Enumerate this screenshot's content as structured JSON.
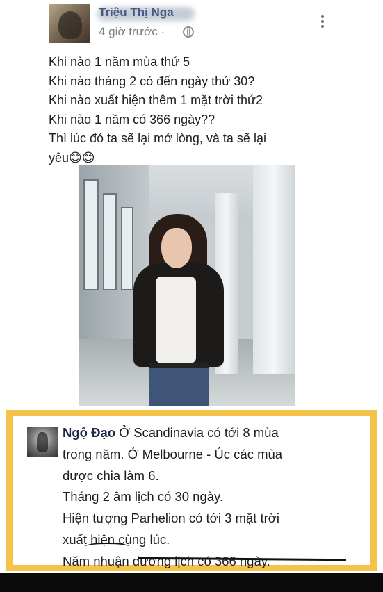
{
  "post": {
    "author": "Triệu Thị Nga",
    "time": "4 giờ trước",
    "time_separator": "·",
    "lines": [
      "Khi nào 1 năm mùa thứ 5",
      "Khi nào tháng 2 có đến ngày thứ 30?",
      "Khi nào xuất hiện thêm 1 mặt trời thứ2",
      "Khi nào 1 năm có 366 ngày??",
      "Thì lúc đó ta sẽ lại mở lòng, và ta sẽ lại",
      "yêu😊😊"
    ]
  },
  "comment": {
    "author": "Ngộ Đạo",
    "first_line": " Ở Scandinavia có tới 8 mùa",
    "lines": [
      "trong năm. Ở Melbourne - Úc các mùa",
      "được chia làm 6.",
      "Tháng 2 âm lịch có 30 ngày.",
      "Hiện tượng Parhelion có tới 3 mặt trời",
      "xuất hiện cùng lúc.",
      "Năm nhuận dương lịch có 366 ngày."
    ]
  },
  "icons": {
    "globe": "globe-icon",
    "more": "more-vertical-icon"
  },
  "colors": {
    "highlight_border": "#f5c34a",
    "author_name": "#485a82"
  }
}
